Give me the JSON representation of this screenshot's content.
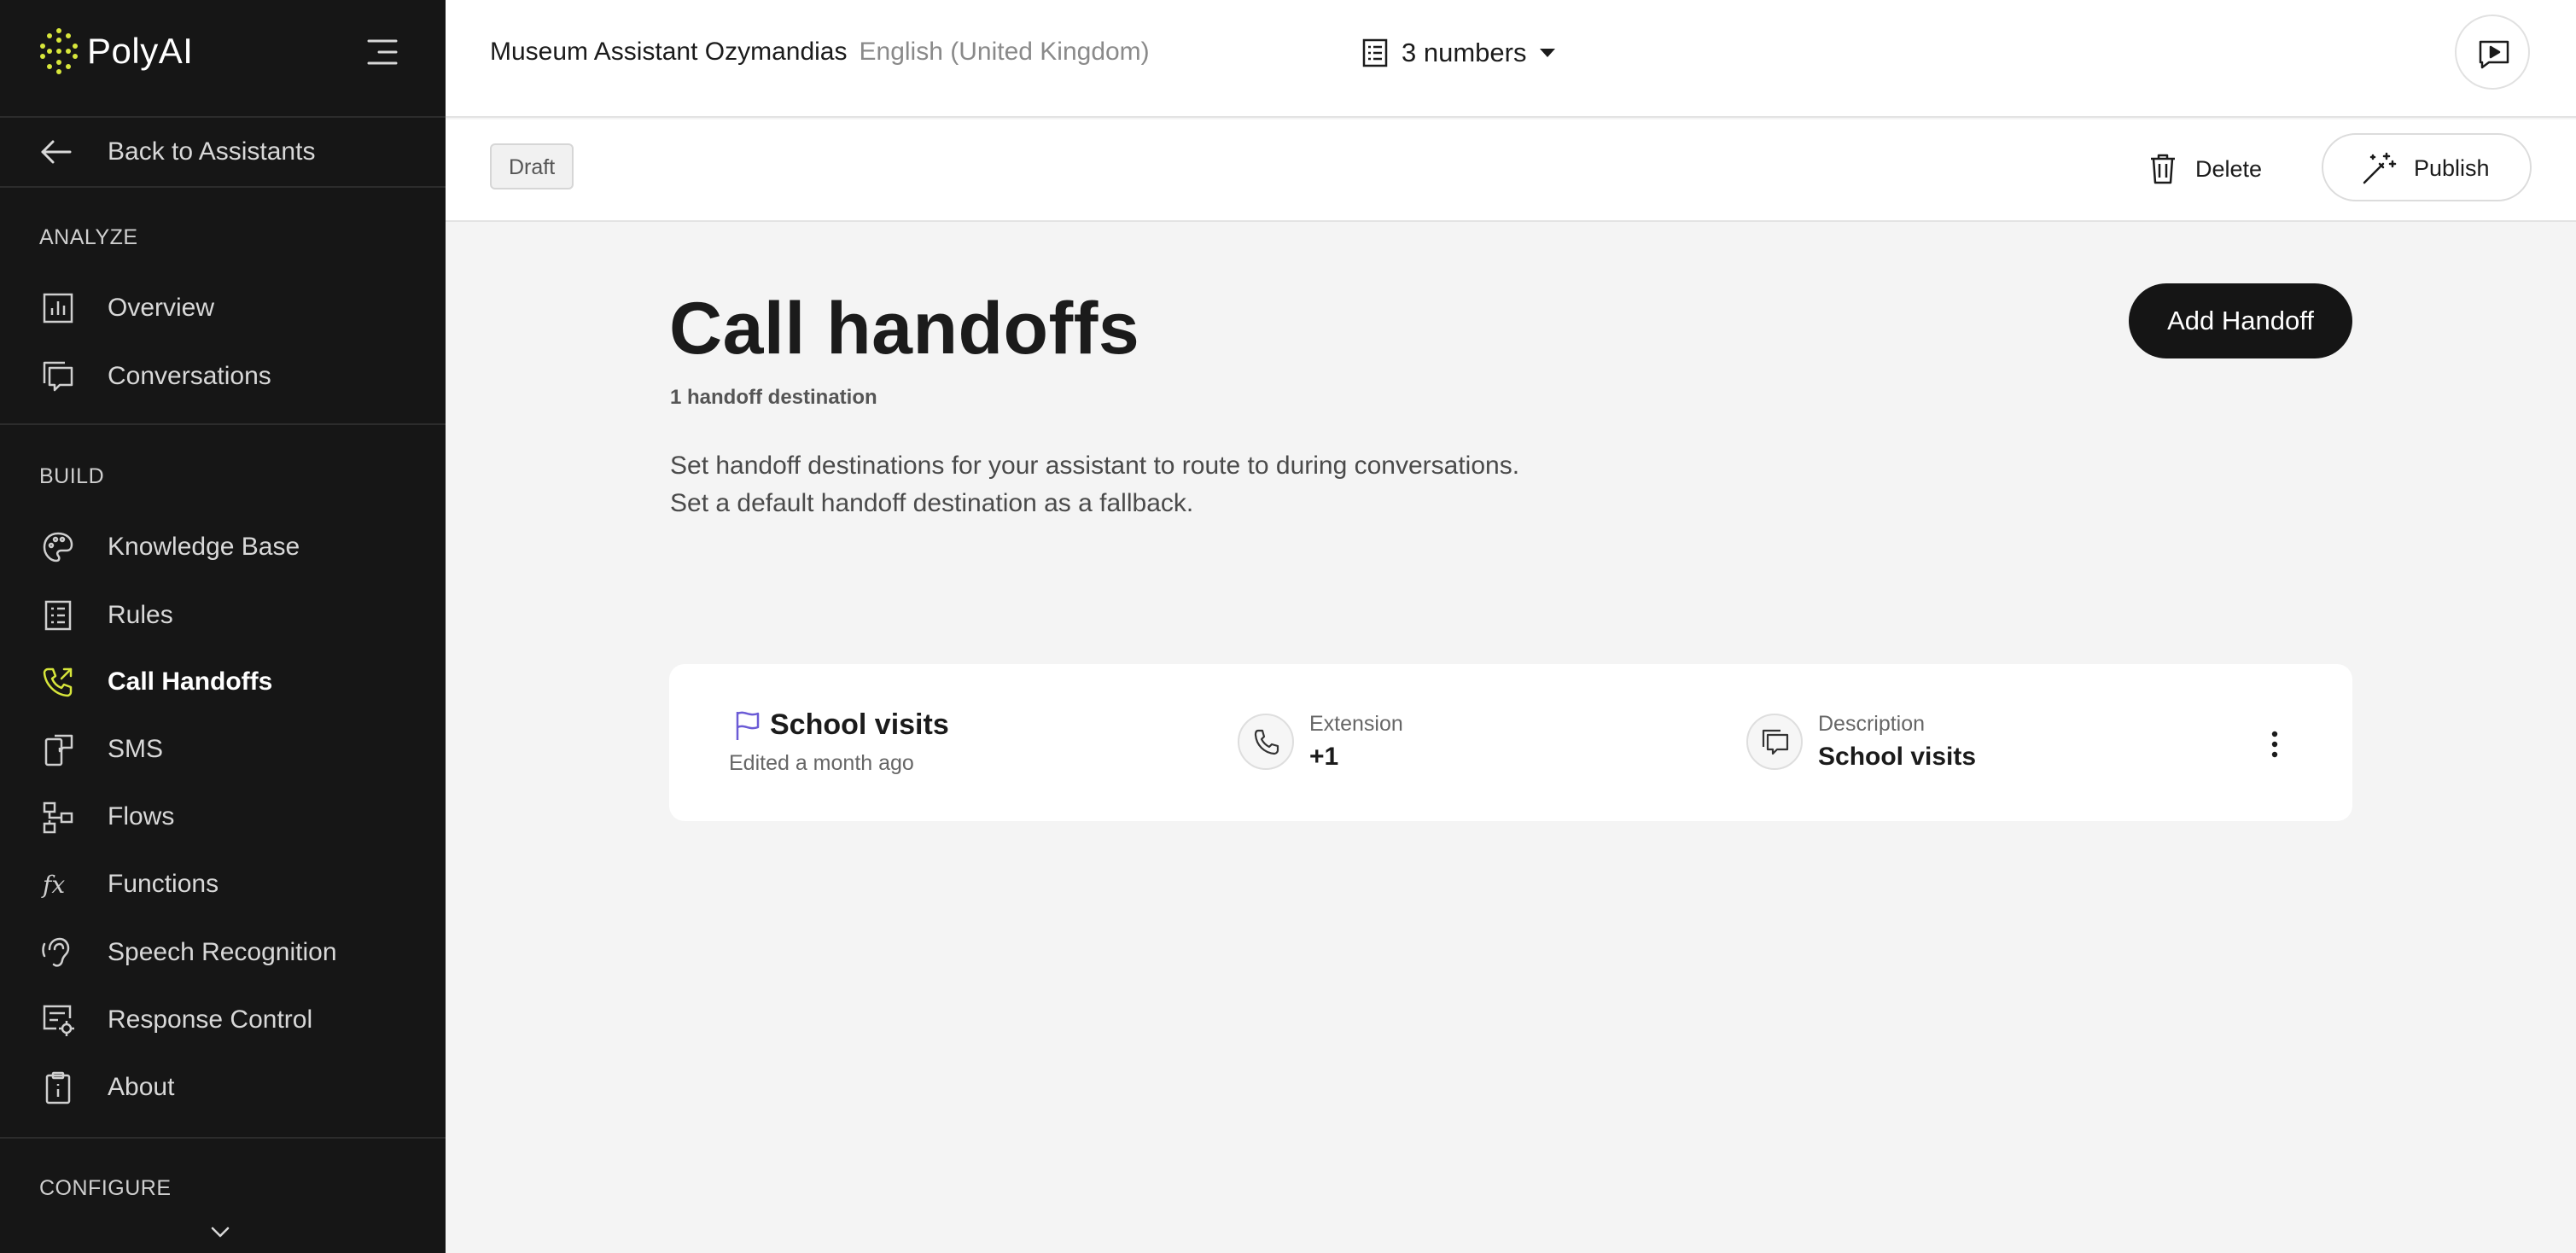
{
  "app": {
    "brand": "PolyAI"
  },
  "sidebar": {
    "back_label": "Back to Assistants",
    "sections": {
      "analyze": "ANALYZE",
      "build": "BUILD",
      "configure": "CONFIGURE"
    },
    "analyze_items": [
      {
        "label": "Overview",
        "icon": "bar-chart-icon"
      },
      {
        "label": "Conversations",
        "icon": "chat-bubbles-icon"
      }
    ],
    "build_items": [
      {
        "label": "Knowledge Base",
        "icon": "palette-icon"
      },
      {
        "label": "Rules",
        "icon": "list-icon"
      },
      {
        "label": "Call Handoffs",
        "icon": "phone-forward-icon",
        "active": true
      },
      {
        "label": "SMS",
        "icon": "sms-icon"
      },
      {
        "label": "Flows",
        "icon": "flows-icon"
      },
      {
        "label": "Functions",
        "icon": "fx-icon"
      },
      {
        "label": "Speech Recognition",
        "icon": "ear-icon"
      },
      {
        "label": "Response Control",
        "icon": "response-control-icon"
      },
      {
        "label": "About",
        "icon": "clipboard-icon"
      }
    ]
  },
  "header": {
    "assistant_name": "Museum Assistant Ozymandias",
    "language": "English (United Kingdom)",
    "numbers_label": "3 numbers"
  },
  "toolbar": {
    "status_badge": "Draft",
    "delete_label": "Delete",
    "publish_label": "Publish"
  },
  "main": {
    "title": "Call handoffs",
    "subtitle": "1 handoff destination",
    "description_line1": "Set handoff destinations for your assistant to route to during conversations.",
    "description_line2": "Set a default handoff destination as a fallback.",
    "add_button": "Add Handoff",
    "handoffs": [
      {
        "name": "School visits",
        "edited": "Edited a month ago",
        "extension_label": "Extension",
        "extension_value": "+1",
        "description_label": "Description",
        "description_value": "School visits"
      }
    ]
  },
  "colors": {
    "sidebar_bg": "#161616",
    "accent_yellow": "#d7e63b",
    "flag_purple": "#6b5bd6",
    "primary_button": "#151515"
  }
}
